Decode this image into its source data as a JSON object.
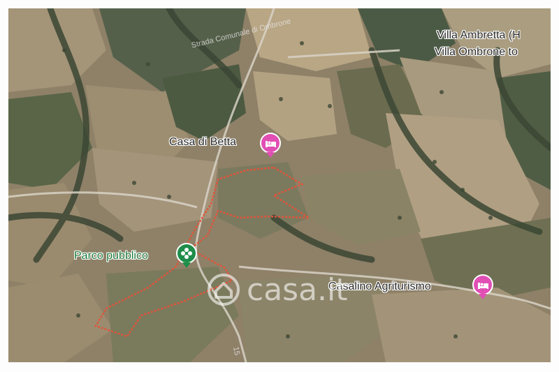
{
  "map": {
    "places": {
      "casa_di_betta": "Casa di Betta",
      "parco_pubblico": "Parco pubblico",
      "casalino_agriturismo": "Casalino Agriturismo",
      "villa_ambretta": "Villa Ambretta (H",
      "villa_ombrone": "Villa Ombrone to"
    },
    "roads": {
      "strada_ombrone": "Strada Comunale di Ombrone",
      "road_number": "15"
    },
    "icons": {
      "hotel": "bed-icon",
      "park": "flower-icon",
      "logo": "house-icon"
    },
    "watermark": "casa.it",
    "colors": {
      "hotel_pin": "#e14fb4",
      "park_pin": "#1f8d4a",
      "boundary": "#e0553a",
      "park_label": "#1d7a3a"
    }
  }
}
